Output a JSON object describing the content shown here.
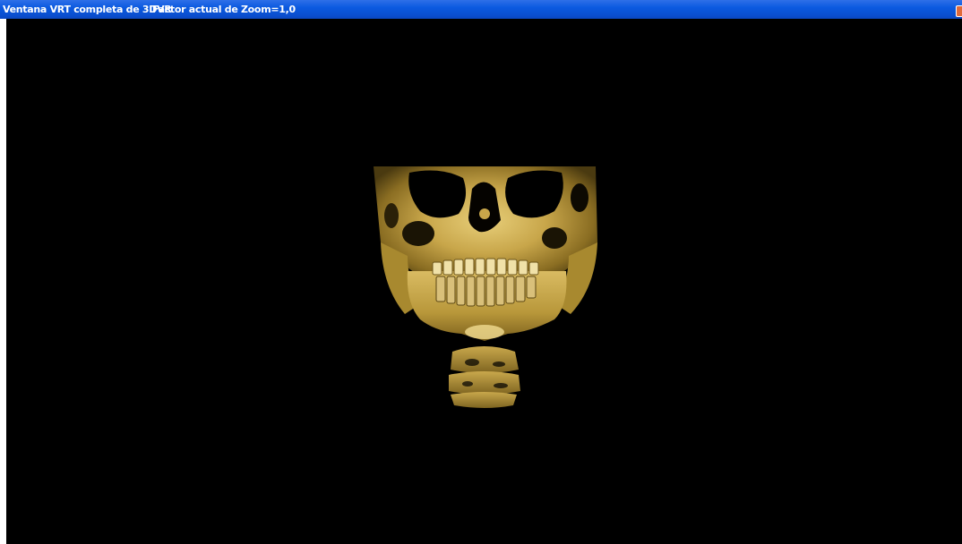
{
  "window": {
    "title": "Ventana VRT completa de 3DVR",
    "zoom_status": "Factor actual de Zoom=1,0"
  },
  "viewport": {
    "render_icon": "skull-3d-volume-render",
    "background_color": "#000000",
    "render_color": "#c8a64a"
  },
  "colors": {
    "titlebar": "#0a54d8",
    "title_text": "#ffffff"
  }
}
